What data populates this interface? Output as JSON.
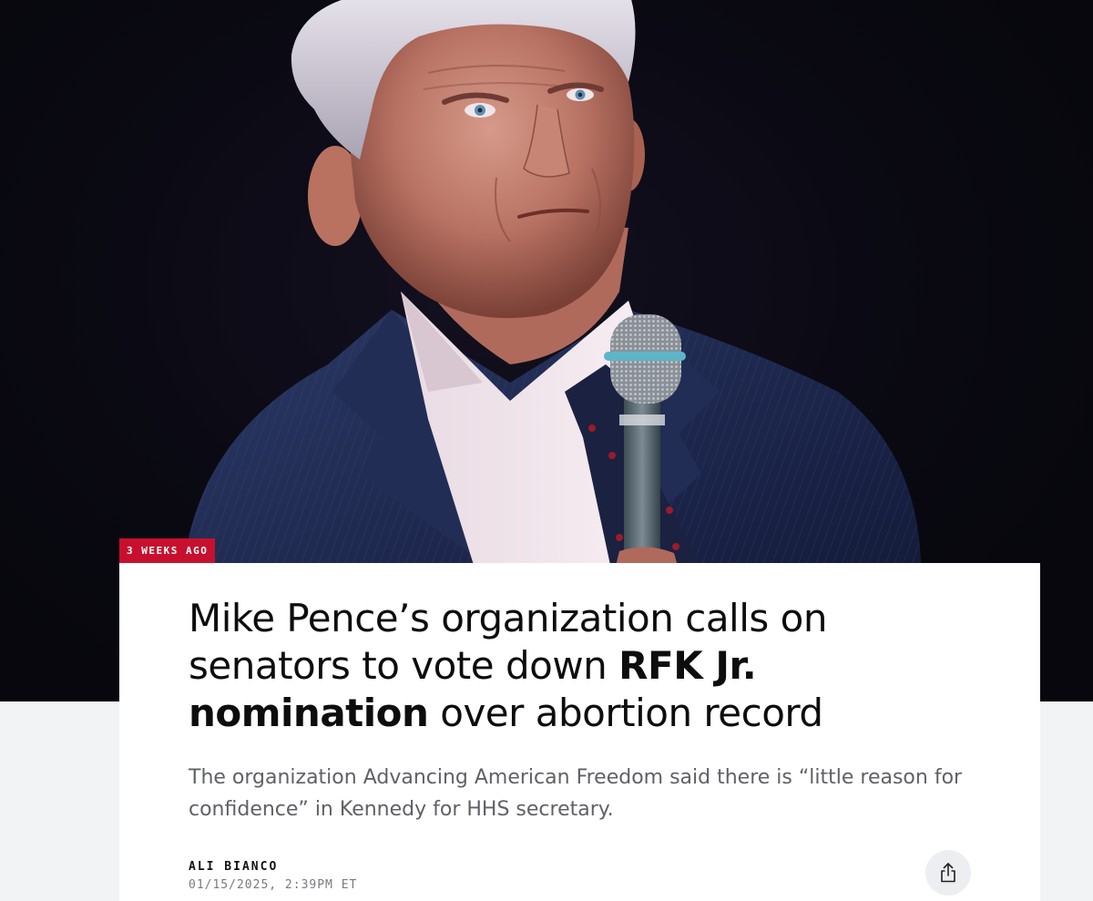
{
  "hero": {
    "photo_icon": "portrait-with-microphone"
  },
  "badge": {
    "label": "3 WEEKS AGO",
    "color": "#c8102e"
  },
  "article": {
    "headline_part1": "Mike Pence’s organization calls on senators to vote down ",
    "headline_bold": "RFK Jr. nomination",
    "headline_part2": " over abortion record",
    "dek": "The organization Advancing American Freedom said there is “little reason for confidence” in Kennedy for HHS secretary.",
    "author": "ALI BIANCO",
    "timestamp": "01/15/2025, 2:39PM ET"
  },
  "actions": {
    "share_icon": "share-icon"
  }
}
